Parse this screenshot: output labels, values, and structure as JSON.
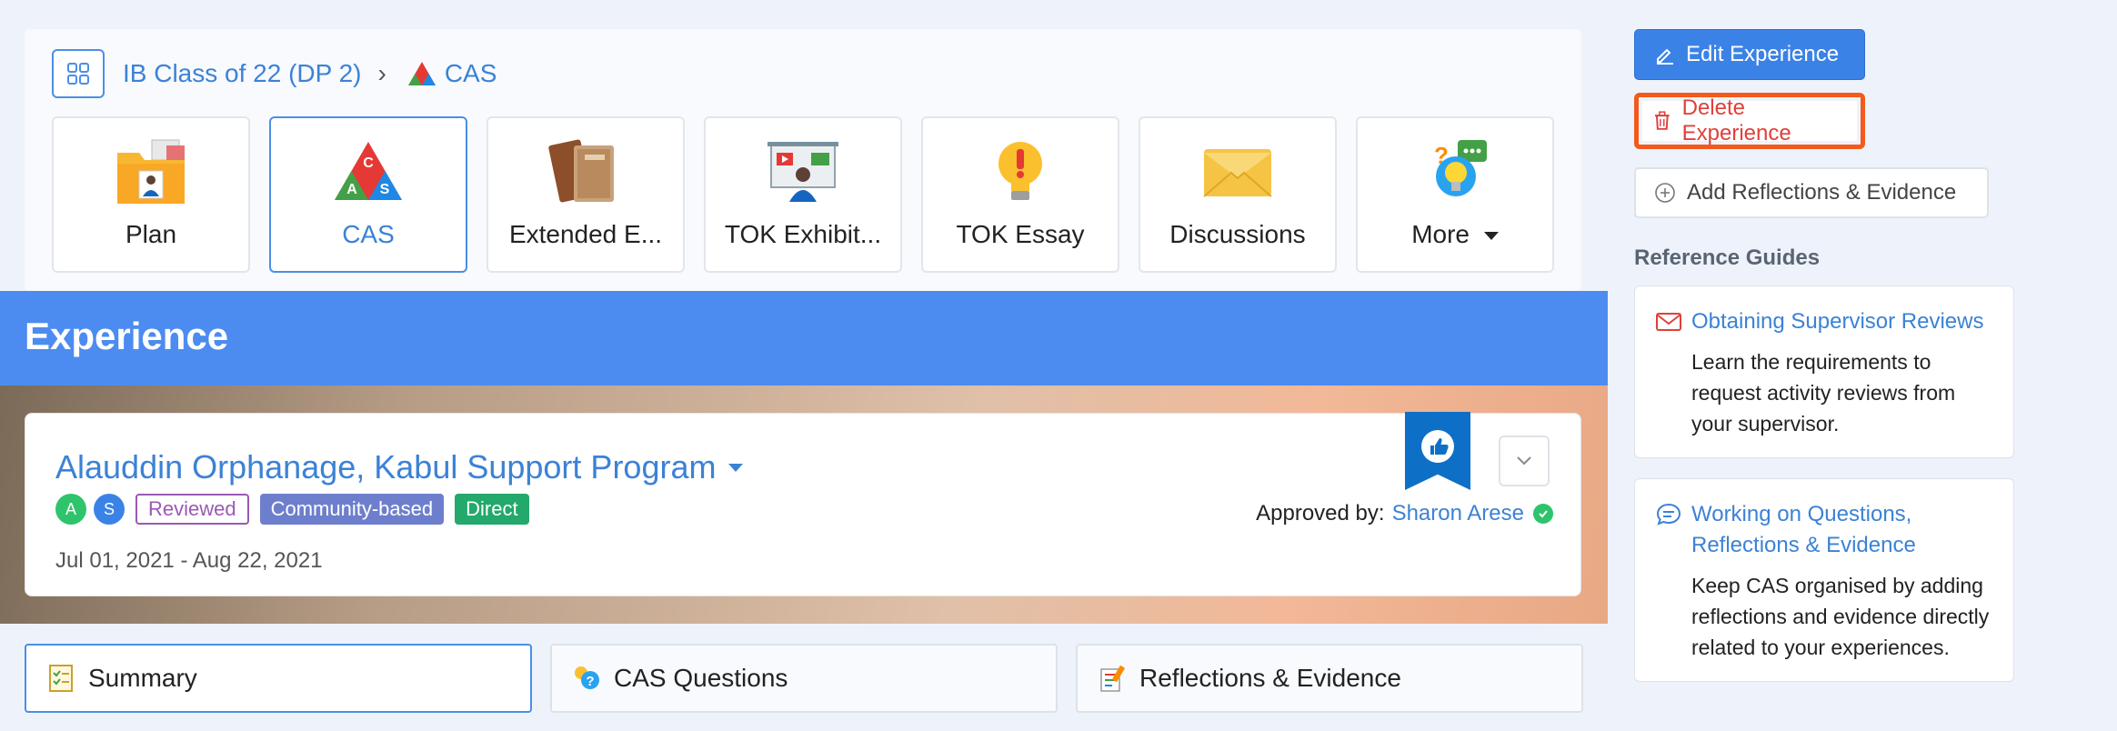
{
  "breadcrumb": {
    "class_name": "IB Class of 22 (DP 2)",
    "separator": "›",
    "current": "CAS"
  },
  "tiles": [
    {
      "label": "Plan",
      "icon": "folder-person-icon"
    },
    {
      "label": "CAS",
      "icon": "cas-triangle-icon",
      "active": true
    },
    {
      "label": "Extended E...",
      "icon": "books-icon"
    },
    {
      "label": "TOK Exhibit...",
      "icon": "presentation-icon"
    },
    {
      "label": "TOK Essay",
      "icon": "lightbulb-icon"
    },
    {
      "label": "Discussions",
      "icon": "envelope-icon"
    },
    {
      "label": "More",
      "icon": "idea-chat-icon"
    }
  ],
  "banner": {
    "title": "Experience"
  },
  "experience": {
    "title": "Alauddin Orphanage, Kabul Support Program",
    "avatars": [
      "A",
      "S"
    ],
    "badges": {
      "reviewed": "Reviewed",
      "category": "Community-based",
      "type": "Direct"
    },
    "dates": "Jul 01, 2021 - Aug 22, 2021",
    "approved_label": "Approved by:",
    "approved_by": "Sharon Arese"
  },
  "tabs": [
    {
      "label": "Summary",
      "icon": "checklist-icon"
    },
    {
      "label": "CAS Questions",
      "icon": "question-people-icon"
    },
    {
      "label": "Reflections & Evidence",
      "icon": "notes-icon"
    }
  ],
  "sidebar": {
    "edit_label": "Edit Experience",
    "delete_label": "Delete Experience",
    "add_label": "Add Reflections & Evidence",
    "reference_title": "Reference Guides",
    "guides": [
      {
        "title": "Obtaining Supervisor Reviews",
        "desc": "Learn the requirements to request activity reviews from your supervisor.",
        "icon": "envelope-outline-icon"
      },
      {
        "title": "Working on Questions, Reflections & Evidence",
        "desc": "Keep CAS organised by adding reflections and evidence directly related to your experiences.",
        "icon": "chat-bubble-icon"
      }
    ]
  },
  "colors": {
    "accent": "#3b82e6",
    "banner": "#4c8cf0",
    "danger": "#e0403a",
    "highlight": "#f35a1c"
  }
}
